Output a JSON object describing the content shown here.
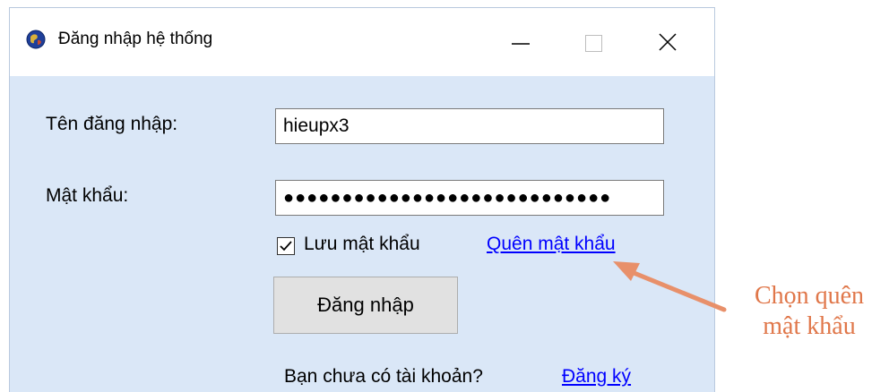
{
  "window": {
    "title": "Đăng nhập hệ thống",
    "app_icon": "globe-icon",
    "controls": [
      "minimize-icon",
      "maximize-icon",
      "close-icon"
    ]
  },
  "form": {
    "username_label": "Tên đăng nhập:",
    "username_value": "hieupx3",
    "password_label": "Mật khẩu:",
    "password_value": "●●●●●●●●●●●●●●●●●●●●●●●●●●●●",
    "remember_label": "Lưu mật khẩu",
    "remember_checked": true,
    "forgot_link": "Quên mật khẩu",
    "login_button": "Đăng nhập",
    "no_account_text": "Bạn chưa có tài khoản?",
    "register_link": "Đăng ký"
  },
  "annotation": {
    "line1": "Chọn quên",
    "line2": "mật khẩu",
    "color": "#e0774a"
  }
}
